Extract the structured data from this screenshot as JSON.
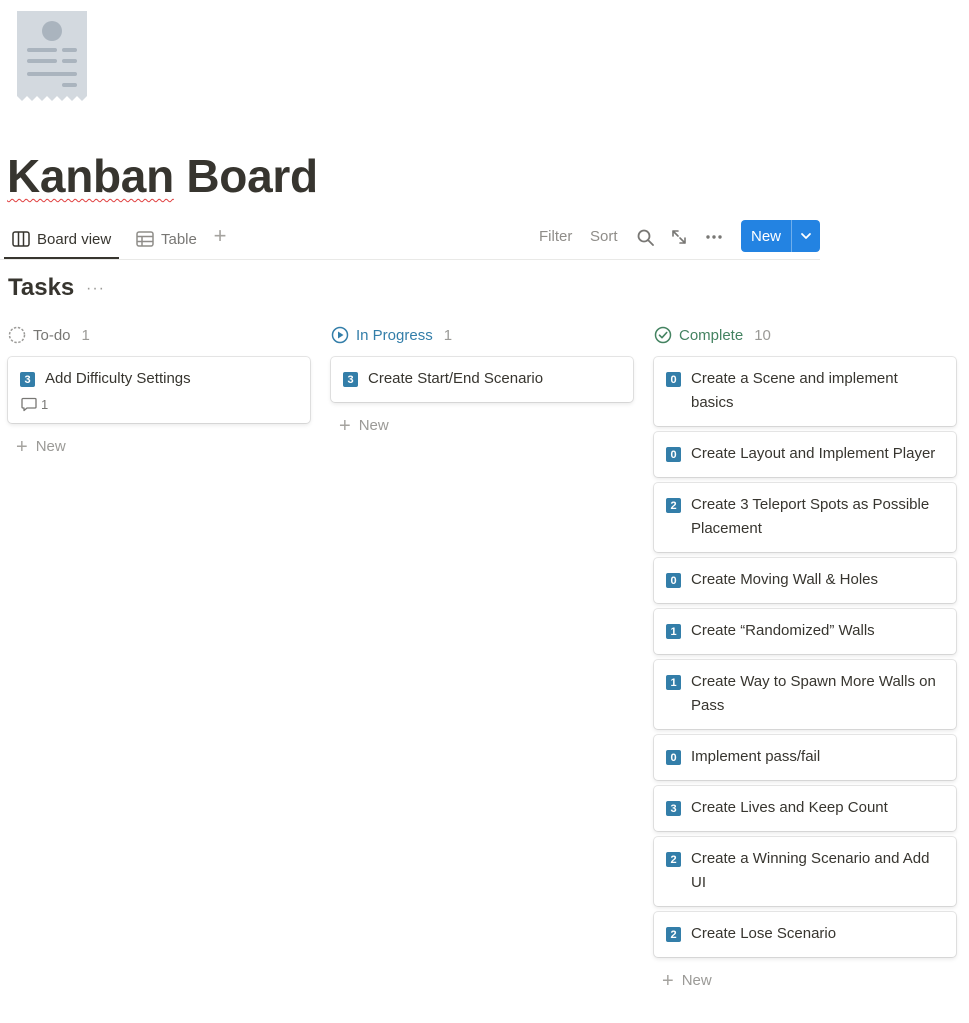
{
  "page": {
    "title_part1": "Kanban",
    "title_part2": " Board"
  },
  "views": [
    {
      "label": "Board view",
      "icon": "board-icon",
      "active": true
    },
    {
      "label": "Table",
      "icon": "table-icon",
      "active": false
    }
  ],
  "toolbar": {
    "filter": "Filter",
    "sort": "Sort",
    "new": "New"
  },
  "database": {
    "title": "Tasks",
    "more": "···"
  },
  "columns": [
    {
      "name": "To-do",
      "count": "1",
      "icon": "todo-status-icon",
      "color": "#787774",
      "cards": [
        {
          "badge": "3",
          "title": "Add Difficulty Settings",
          "comments": "1"
        }
      ],
      "add_label": "New"
    },
    {
      "name": "In Progress",
      "count": "1",
      "icon": "in-progress-status-icon",
      "color": "#337ea9",
      "cards": [
        {
          "badge": "3",
          "title": "Create Start/End Scenario"
        }
      ],
      "add_label": "New"
    },
    {
      "name": "Complete",
      "count": "10",
      "icon": "complete-status-icon",
      "color": "#448361",
      "cards": [
        {
          "badge": "0",
          "title": "Create a Scene and implement basics"
        },
        {
          "badge": "0",
          "title": "Create Layout and Implement Player"
        },
        {
          "badge": "2",
          "title": "Create 3 Teleport Spots as Possible Placement"
        },
        {
          "badge": "0",
          "title": "Create Moving Wall & Holes"
        },
        {
          "badge": "1",
          "title": "Create “Randomized” Walls"
        },
        {
          "badge": "1",
          "title": "Create Way to Spawn More Walls on Pass"
        },
        {
          "badge": "0",
          "title": "Implement pass/fail"
        },
        {
          "badge": "3",
          "title": "Create Lives and Keep Count"
        },
        {
          "badge": "2",
          "title": "Create a Winning Scenario and Add UI"
        },
        {
          "badge": "2",
          "title": "Create Lose Scenario"
        }
      ],
      "add_label": "New"
    }
  ]
}
